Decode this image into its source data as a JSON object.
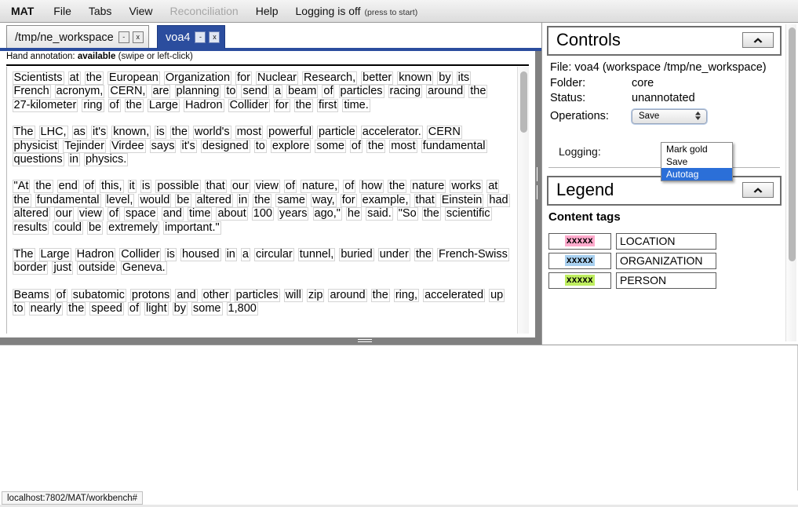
{
  "app": {
    "brand": "MAT",
    "status_url": "localhost:7802/MAT/workbench#"
  },
  "menu": {
    "items": [
      {
        "label": "MAT",
        "disabled": false,
        "brand": true
      },
      {
        "label": "File",
        "disabled": false,
        "brand": false
      },
      {
        "label": "Tabs",
        "disabled": false,
        "brand": false
      },
      {
        "label": "View",
        "disabled": false,
        "brand": false
      },
      {
        "label": "Reconciliation",
        "disabled": true,
        "brand": false
      },
      {
        "label": "Help",
        "disabled": false,
        "brand": false
      }
    ],
    "logging_label": "Logging is off",
    "logging_hint": "(press to start)"
  },
  "tabs": [
    {
      "label": "/tmp/ne_workspace",
      "active": false,
      "minimize": "-",
      "close": "x"
    },
    {
      "label": "voa4",
      "active": true,
      "minimize": "-",
      "close": "x"
    }
  ],
  "document": {
    "hand_annotation_prefix": "Hand annotation:",
    "hand_annotation_value": "available",
    "hand_annotation_hint": "(swipe or left-click)",
    "paragraphs": [
      "Scientists at the European Organization for Nuclear Research, better known by its French acronym, CERN, are planning to send a beam of particles racing around the 27-kilometer ring of the Large Hadron Collider for the first time.",
      "The LHC, as it's known, is the world's most powerful particle accelerator. CERN physicist Tejinder Virdee says it's designed to explore some of the most fundamental questions in physics.",
      "\"At the end of this, it is possible that our view of nature, of how the nature works at the fundamental level, would be altered in the same way, for example, that Einstein had altered our view of space and time about 100 years ago,\" he said. \"So the scientific results could be extremely important.\"",
      "The Large Hadron Collider is housed in a circular tunnel, buried under the French-Swiss border just outside Geneva.",
      "Beams of subatomic protons and other particles will zip around the ring, accelerated up to nearly the speed of light by some 1,800"
    ]
  },
  "controls": {
    "title": "Controls",
    "collapse_icon": "chevron-up-icon",
    "file_line": "File: voa4 (workspace /tmp/ne_workspace)",
    "rows": [
      {
        "key": "Folder:",
        "value": "core"
      },
      {
        "key": "Status:",
        "value": "unannotated"
      }
    ],
    "operations_label": "Operations:",
    "operations_selected": "Save",
    "operations_options": [
      "Mark gold",
      "Save",
      "Autotag"
    ],
    "operations_highlighted": "Autotag",
    "logging_label": "Logging:"
  },
  "legend": {
    "title": "Legend",
    "collapse_icon": "chevron-up-icon",
    "section_title": "Content tags",
    "swatch_text": "xxxxx",
    "tags": [
      {
        "name": "LOCATION",
        "color": "#ffaacc"
      },
      {
        "name": "ORGANIZATION",
        "color": "#a8d0f0"
      },
      {
        "name": "PERSON",
        "color": "#bfee60"
      }
    ]
  }
}
